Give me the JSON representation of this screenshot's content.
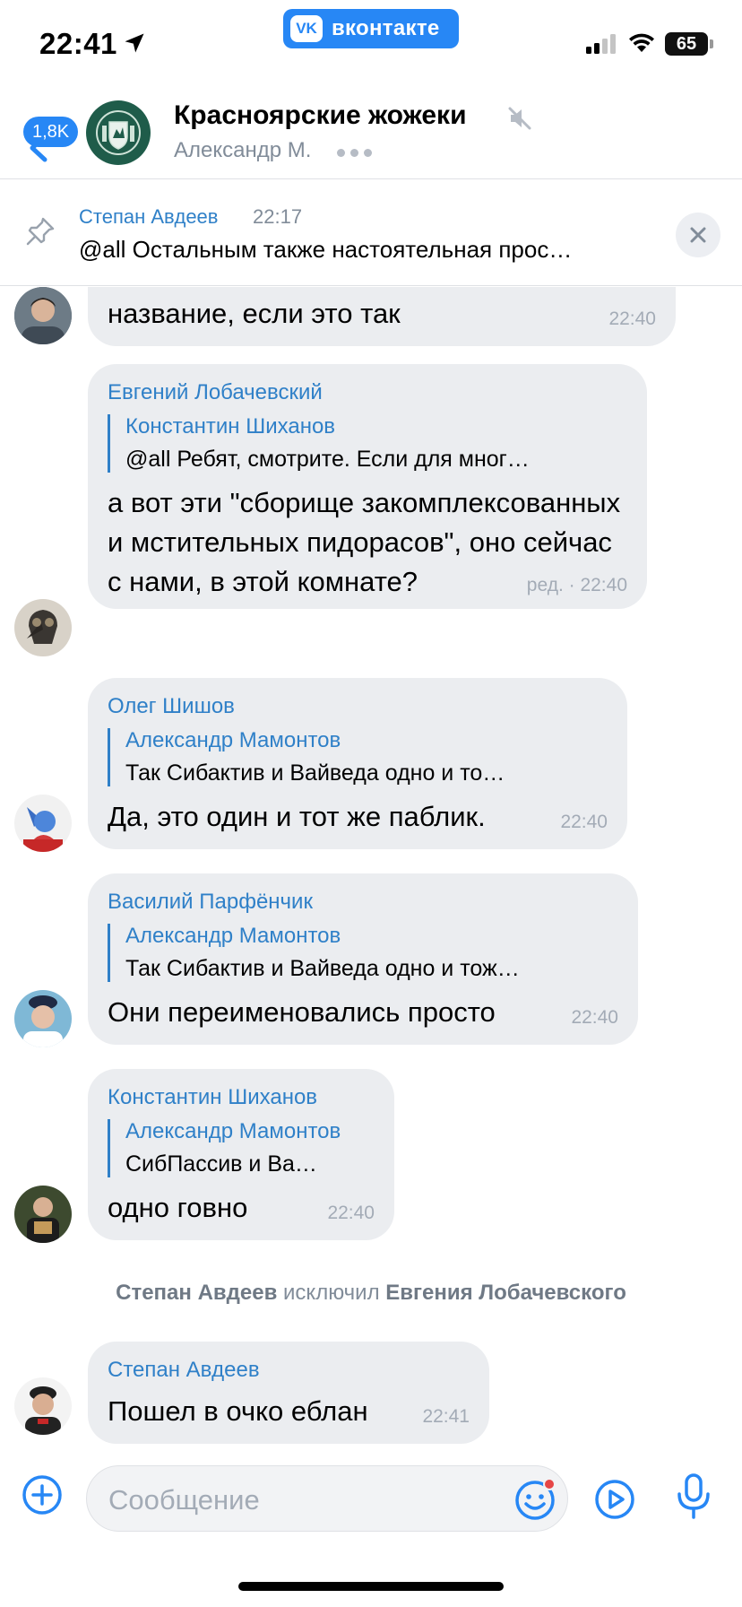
{
  "status_bar": {
    "time": "22:41",
    "app_badge": "вконтакте",
    "battery": "65"
  },
  "header": {
    "unread_badge": "1,8K",
    "title": "Красноярские жожеки",
    "subtitle": "Александр М."
  },
  "pinned": {
    "author": "Степан Авдеев",
    "time": "22:17",
    "text": "@all Остальным также настоятельная прос…"
  },
  "messages": [
    {
      "partial_text": "название, если это так",
      "time": "22:40"
    },
    {
      "author": "Евгений Лобачевский",
      "reply_author": "Константин Шиханов",
      "reply_text": "@all Ребят, смотрите. Если для мног…",
      "text": "а вот эти \"сборище закомплексованных и мстительных пидорасов\", оно сейчас с нами, в этой комнате?",
      "time": "ред. · 22:40"
    },
    {
      "author": "Олег Шишов",
      "reply_author": "Александр Мамонтов",
      "reply_text": "Так Сибактив и Вайведа одно и то…",
      "text": "Да, это один и тот же паблик.",
      "time": "22:40"
    },
    {
      "author": "Василий Парфёнчик",
      "reply_author": "Александр Мамонтов",
      "reply_text": "Так Сибактив и Вайведа одно и тож…",
      "text": "Они переименовались просто",
      "time": "22:40"
    },
    {
      "author": "Константин Шиханов",
      "reply_author": "Александр Мамонтов",
      "reply_text": "СибПассив и Ва…",
      "text": "одно говно",
      "time": "22:40"
    },
    {
      "author": "Степан Авдеев",
      "text": "Пошел в очко еблан",
      "time": "22:41"
    }
  ],
  "service": {
    "actor": "Степан Авдеев",
    "action": "исключил",
    "target": "Евгения Лобачевского"
  },
  "composer": {
    "placeholder": "Сообщение"
  },
  "colors": {
    "accent": "#2787F5",
    "link": "#2f80c8",
    "bubble": "#ebedf0",
    "secondary": "#818c99"
  }
}
